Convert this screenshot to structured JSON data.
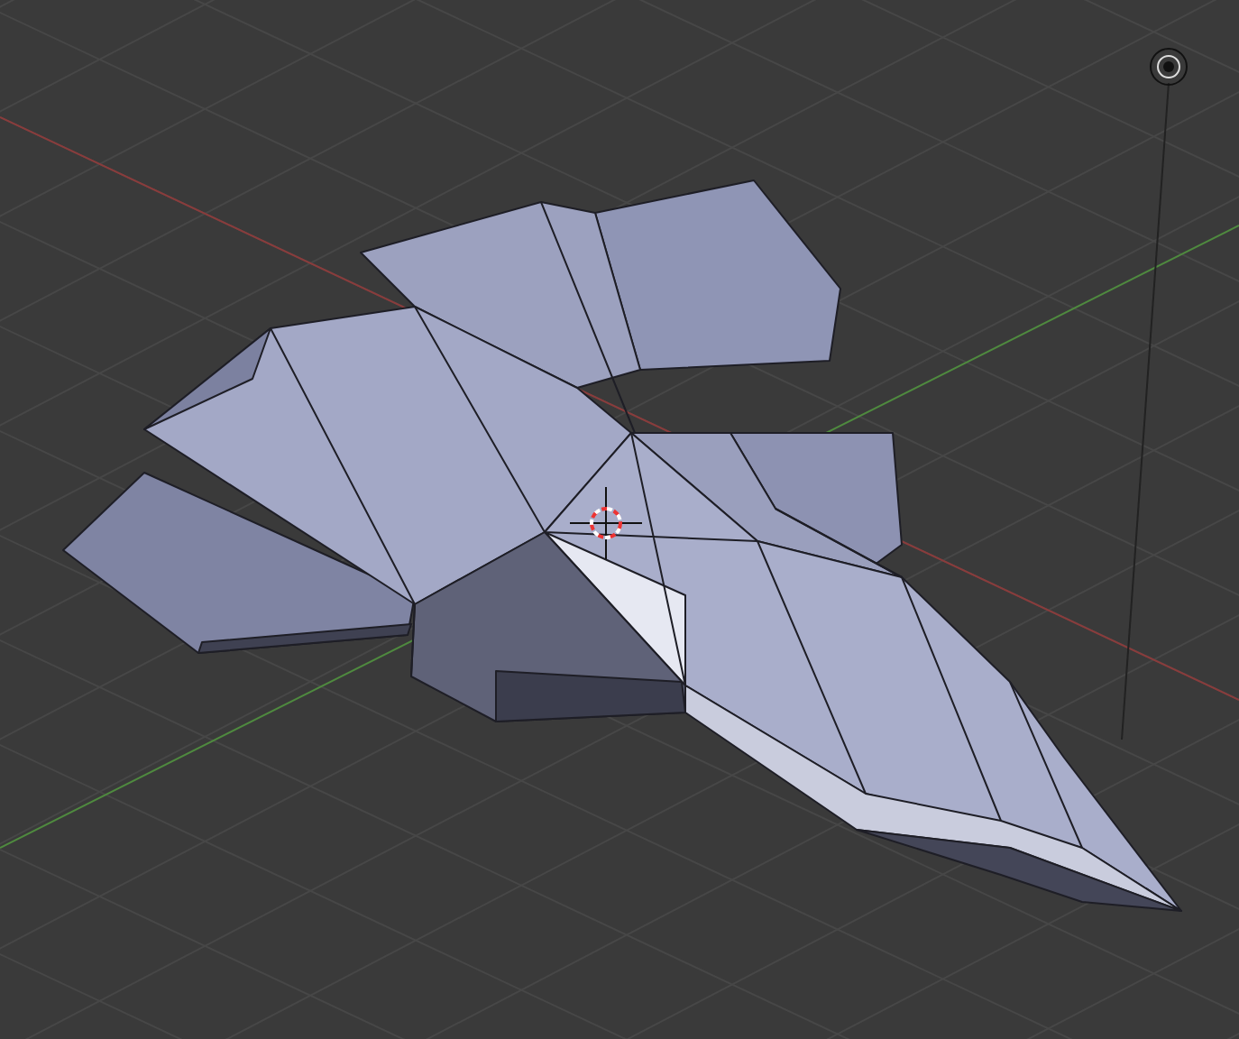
{
  "viewport": {
    "objects": [
      {
        "kind": "mesh"
      },
      {
        "kind": "cursor"
      },
      {
        "kind": "lamp"
      }
    ]
  }
}
